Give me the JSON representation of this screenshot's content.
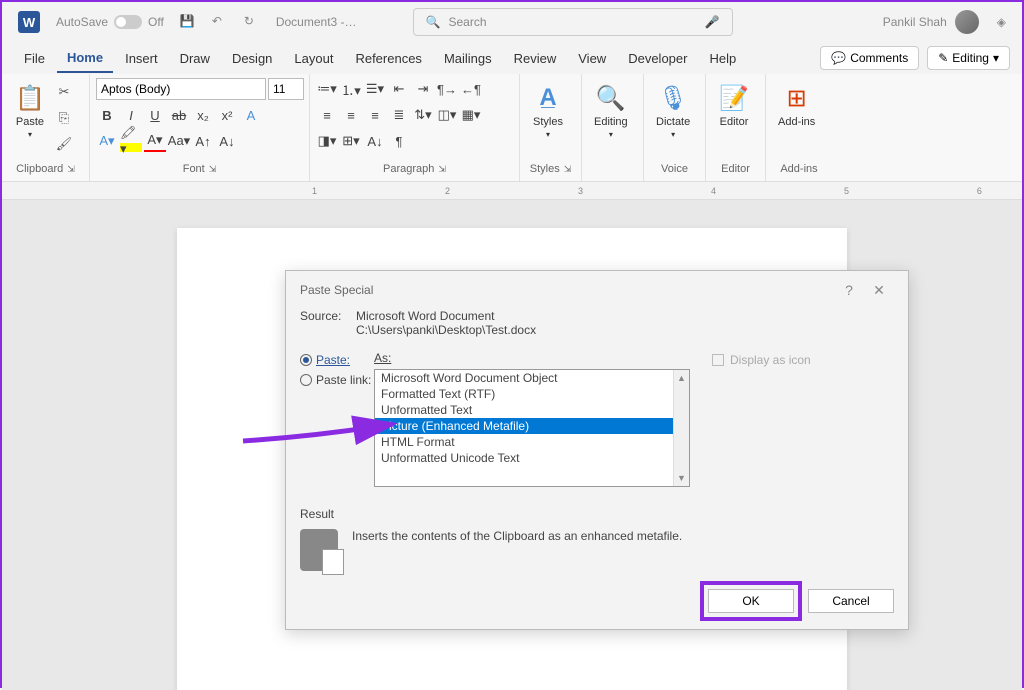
{
  "titlebar": {
    "autosave_label": "AutoSave",
    "autosave_state": "Off",
    "doc_name": "Document3 -…",
    "search_placeholder": "Search",
    "user_name": "Pankil Shah"
  },
  "menu": {
    "items": [
      "File",
      "Home",
      "Insert",
      "Draw",
      "Design",
      "Layout",
      "References",
      "Mailings",
      "Review",
      "View",
      "Developer",
      "Help"
    ],
    "active_index": 1,
    "comments_btn": "Comments",
    "editing_btn": "Editing"
  },
  "ribbon": {
    "clipboard": {
      "label": "Clipboard",
      "paste": "Paste"
    },
    "font": {
      "label": "Font",
      "family": "Aptos (Body)",
      "size": "11"
    },
    "paragraph": {
      "label": "Paragraph"
    },
    "styles": {
      "label": "Styles",
      "btn": "Styles"
    },
    "editing": {
      "label": "Editing",
      "btn": "Editing"
    },
    "voice": {
      "label": "Voice",
      "btn": "Dictate"
    },
    "editor": {
      "label": "Editor",
      "btn": "Editor"
    },
    "addins": {
      "label": "Add-ins",
      "btn": "Add-ins"
    }
  },
  "ruler_marks": [
    "1",
    "2",
    "3",
    "4",
    "5",
    "6"
  ],
  "dialog": {
    "title": "Paste Special",
    "source_label": "Source:",
    "source_doc": "Microsoft Word Document",
    "source_path": "C:\\Users\\panki\\Desktop\\Test.docx",
    "paste_radio": "Paste:",
    "paste_link_radio": "Paste link:",
    "as_label": "As:",
    "list_items": [
      "Microsoft Word Document Object",
      "Formatted Text (RTF)",
      "Unformatted Text",
      "Picture (Enhanced Metafile)",
      "HTML Format",
      "Unformatted Unicode Text"
    ],
    "selected_index": 3,
    "display_icon": "Display as icon",
    "result_label": "Result",
    "result_desc": "Inserts the contents of the Clipboard as an enhanced metafile.",
    "ok_btn": "OK",
    "cancel_btn": "Cancel"
  }
}
